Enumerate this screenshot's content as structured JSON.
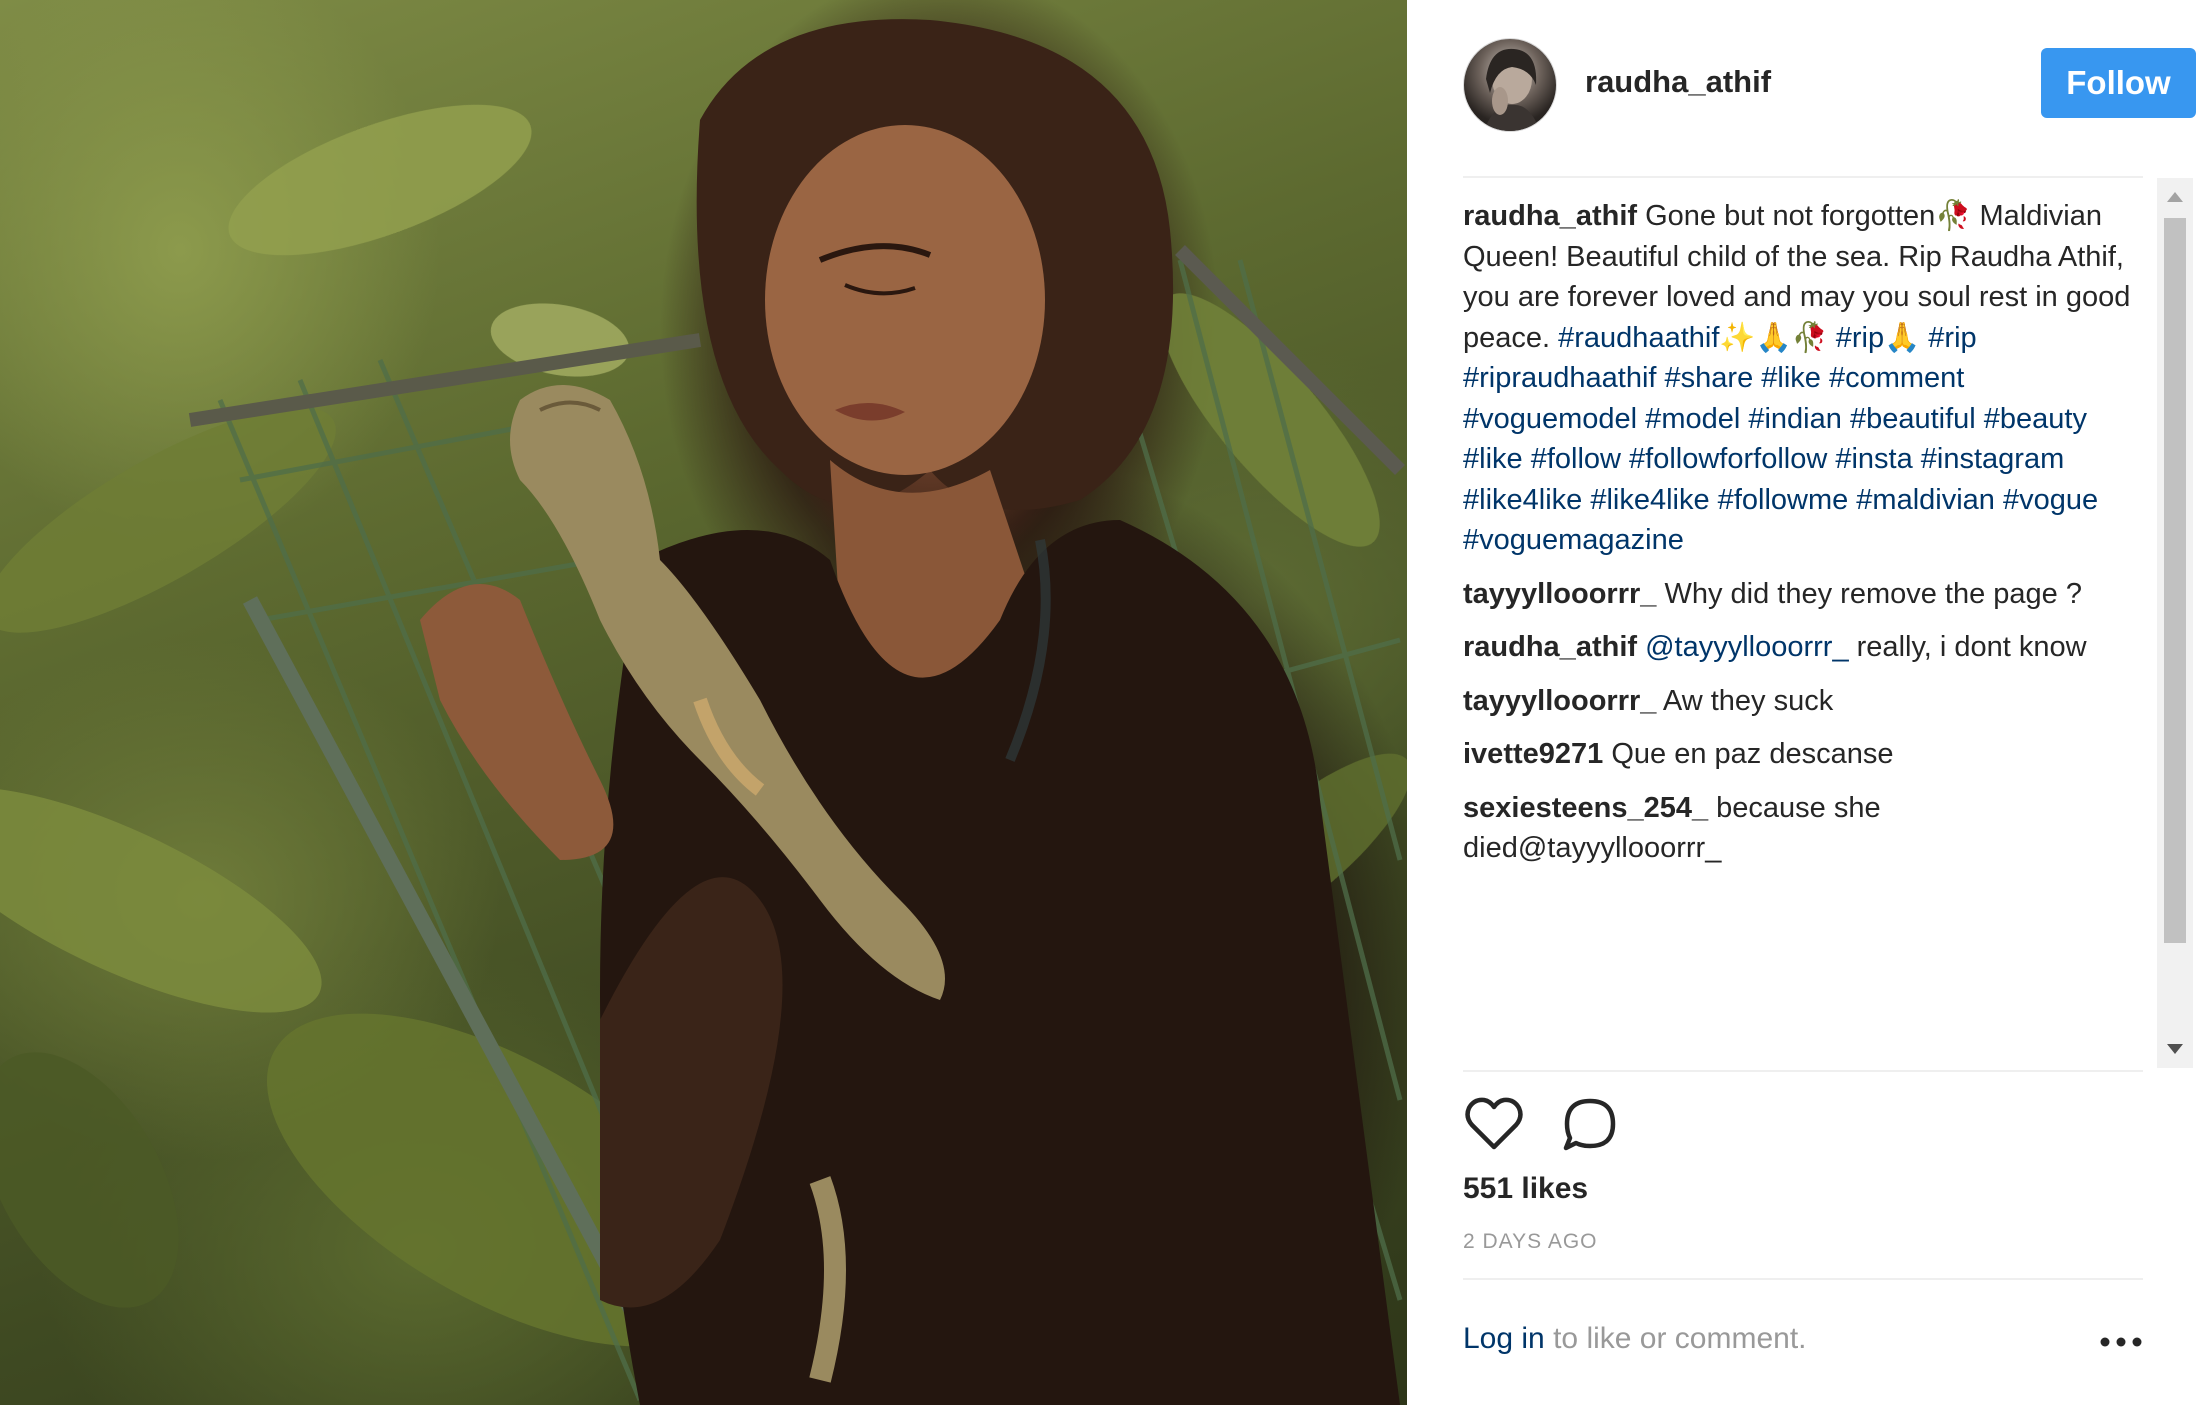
{
  "post": {
    "author": "raudha_athif",
    "follow_label": "Follow",
    "likes": "551 likes",
    "time": "2 DAYS AGO",
    "login_link": "Log in",
    "login_rest": " to like or comment.",
    "more_label": "•••"
  },
  "caption": {
    "user": "raudha_athif",
    "text": " Gone but not forgotten🥀 Maldivian Queen! Beautiful child of the sea. Rip Raudha Athif, you are forever loved and may you soul rest in good peace.",
    "tags": "#raudhaathif✨🙏🥀 #rip🙏 #rip #ripraudhaathif #share #like #comment #voguemodel #model #indian #beautiful #beauty #like #follow #followforfollow #insta #instagram #like4like #like4like #followme #maldivian #vogue #voguemagazine"
  },
  "comments": [
    {
      "user": "tayyyllooorrr_",
      "text": " Why did they remove the page ?"
    },
    {
      "user": "raudha_athif",
      "mention": " @tayyyllooorrr_",
      "text": " really, i dont know"
    },
    {
      "user": "tayyyllooorrr_",
      "text": " Aw they suck"
    },
    {
      "user": "ivette9271",
      "text": " Que en paz descanse"
    },
    {
      "user": "sexiesteens_254_",
      "text": " because she died@tayyyllooorrr_"
    }
  ],
  "icons": {
    "like": "heart-outline",
    "comment": "speech-bubble-outline",
    "more": "ellipsis"
  },
  "colors": {
    "follow_button": "#3897f0",
    "hashtag": "#003569",
    "muted": "#999999"
  }
}
